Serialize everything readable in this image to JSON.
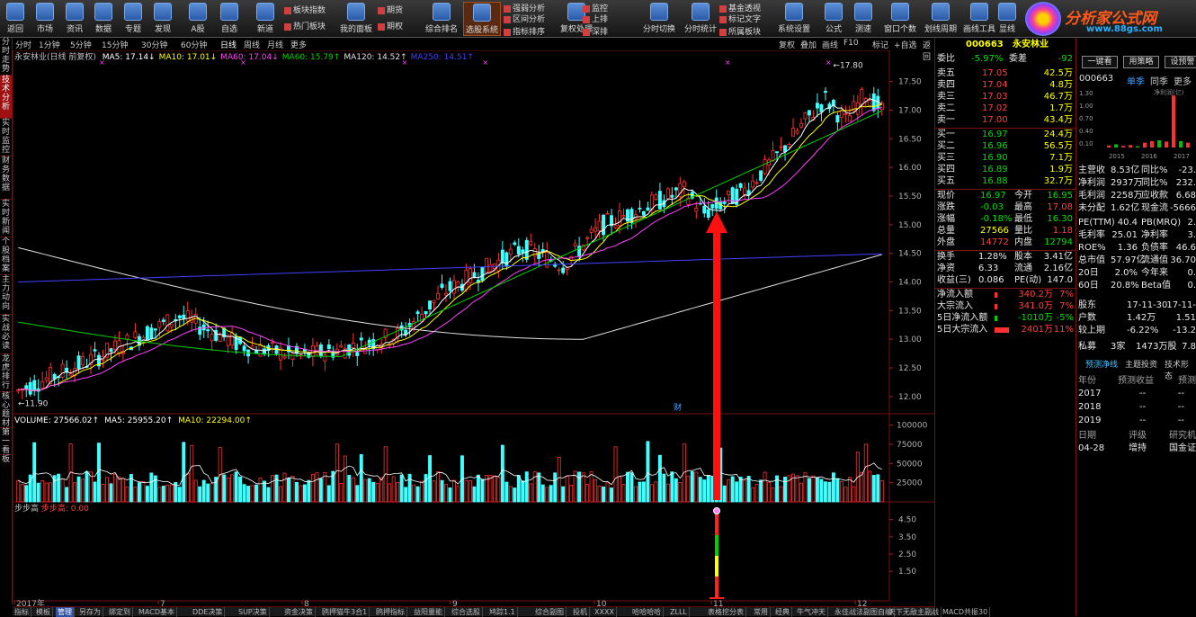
{
  "toolbar": {
    "buttons": [
      {
        "label": "返回",
        "icon": "back-icon"
      },
      {
        "label": "市场",
        "icon": "home-icon"
      },
      {
        "label": "资讯",
        "icon": "home-icon"
      },
      {
        "label": "数据",
        "icon": "home-icon"
      },
      {
        "label": "专题",
        "icon": "home-icon"
      },
      {
        "label": "发现",
        "icon": "home-icon"
      },
      {
        "label": "A股",
        "icon": "chart-icon"
      },
      {
        "label": "自选",
        "icon": "chart-icon"
      },
      {
        "label": "新道",
        "icon": "tools-icon"
      },
      {
        "label": "我的面板",
        "icon": "panel-icon"
      },
      {
        "label": "综合排名",
        "icon": "week-icon"
      },
      {
        "label": "选股系统",
        "icon": "week-icon"
      },
      {
        "label": "复权处理",
        "icon": "magnifier-icon"
      },
      {
        "label": "分时切换",
        "icon": "cursor-icon"
      },
      {
        "label": "分时统计",
        "icon": "pie-icon"
      },
      {
        "label": "系统设置",
        "icon": "settings-icon"
      },
      {
        "label": "公式",
        "icon": "mic-icon"
      },
      {
        "label": "测速",
        "icon": "printer-icon"
      },
      {
        "label": "窗口个数",
        "icon": "week-icon"
      },
      {
        "label": "划线周期",
        "icon": "week-icon"
      },
      {
        "label": "画线工具",
        "icon": "chart-icon"
      },
      {
        "label": "显线",
        "icon": "chart-icon"
      }
    ],
    "small": [
      "板块指数",
      "热门板块",
      "期货",
      "期权",
      "强弱分析",
      "区间分析",
      "指标排序",
      "监控",
      "上排",
      "深排",
      "基金透视",
      "标记文字",
      "所属板块"
    ]
  },
  "logo": {
    "title": "分析家公式网",
    "url": "www.88gs.com"
  },
  "left_tabs": [
    "分时走势",
    "技术分析",
    "实时监控",
    "财务数据",
    "实时新闻",
    "个股档案",
    "主力动向",
    "实战必读",
    "龙虎排行",
    "核心题材",
    "第一看板"
  ],
  "period_bar": [
    "分时",
    "1分钟",
    "5分钟",
    "15分钟",
    "30分钟",
    "60分钟",
    "日线",
    "周线",
    "月线",
    "更多"
  ],
  "period_right": [
    "复权",
    "叠加",
    "画线",
    "F10",
    "标记",
    "+自选",
    "返回"
  ],
  "chart_data": {
    "type": "candlestick",
    "title": "永安林业(日线 前复权)",
    "ma_legend": [
      {
        "label": "MA5: 17.14↓",
        "color": "#ffffff"
      },
      {
        "label": "MA10: 17.01↓",
        "color": "#ffff00"
      },
      {
        "label": "MA60: 17.04↓",
        "color": "#ff40ff"
      },
      {
        "label": "MA60: 15.79↑",
        "color": "#00d000"
      },
      {
        "label": "MA120: 14.52↑",
        "color": "#e0e0e0"
      },
      {
        "label": "MA250: 14.51↑",
        "color": "#4040ff"
      }
    ],
    "y_ticks": [
      17.5,
      17.0,
      16.5,
      16.0,
      15.5,
      15.0,
      14.5,
      14.0,
      13.5,
      13.0,
      12.5,
      12.0
    ],
    "y_range": [
      11.7,
      17.95
    ],
    "high_label": "17.80",
    "low_label": "11.90",
    "x_labels": [
      "2017年",
      "7",
      "8",
      "9",
      "10",
      "11",
      "12"
    ],
    "volume_legend": [
      {
        "label": "VOLUME: 27566.02↑",
        "color": "#ffffff"
      },
      {
        "label": "MA5: 25955.20↑",
        "color": "#ffffff"
      },
      {
        "label": "MA10: 22294.00↑",
        "color": "#ffff00"
      }
    ],
    "volume_ticks": [
      100000,
      75000,
      50000,
      25000
    ],
    "indicator_name": "步步高",
    "indicator_value": "步步高: 0.00",
    "indicator_ticks": [
      4.5,
      3.5,
      2.5,
      1.5
    ],
    "arrow_color": "#ff1010",
    "event_marker": "财"
  },
  "quote": {
    "code": "000663",
    "name": "永安林业",
    "weibi_label": "委比",
    "weibi": "-5.97%",
    "weicha_label": "委差",
    "weicha": "-92",
    "asks": [
      {
        "label": "卖五",
        "price": "17.05",
        "vol": "42.5万"
      },
      {
        "label": "卖四",
        "price": "17.04",
        "vol": "4.8万"
      },
      {
        "label": "卖三",
        "price": "17.03",
        "vol": "46.7万"
      },
      {
        "label": "卖二",
        "price": "17.02",
        "vol": "1.7万"
      },
      {
        "label": "卖一",
        "price": "17.00",
        "vol": "43.4万"
      }
    ],
    "bids": [
      {
        "label": "买一",
        "price": "16.97",
        "vol": "24.4万"
      },
      {
        "label": "买二",
        "price": "16.96",
        "vol": "56.5万"
      },
      {
        "label": "买三",
        "price": "16.90",
        "vol": "7.1万"
      },
      {
        "label": "买四",
        "price": "16.89",
        "vol": "1.9万"
      },
      {
        "label": "买五",
        "price": "16.88",
        "vol": "32.7万"
      }
    ],
    "stats": [
      {
        "l1": "现价",
        "v1": "16.97",
        "c1": "green",
        "l2": "今开",
        "v2": "16.95",
        "c2": "green"
      },
      {
        "l1": "涨跌",
        "v1": "-0.03",
        "c1": "green",
        "l2": "最高",
        "v2": "17.08",
        "c2": "red"
      },
      {
        "l1": "涨幅",
        "v1": "-0.18%",
        "c1": "green",
        "l2": "最低",
        "v2": "16.30",
        "c2": "green"
      },
      {
        "l1": "总量",
        "v1": "27566",
        "c1": "yellow",
        "l2": "量比",
        "v2": "1.18",
        "c2": "red"
      },
      {
        "l1": "外盘",
        "v1": "14772",
        "c1": "red",
        "l2": "内盘",
        "v2": "12794",
        "c2": "green"
      }
    ],
    "stats2": [
      {
        "l1": "换手",
        "v1": "1.28%",
        "l2": "股本",
        "v2": "3.41亿"
      },
      {
        "l1": "净资",
        "v1": "6.33",
        "l2": "流通",
        "v2": "2.16亿"
      },
      {
        "l1": "收益(三)",
        "v1": "0.086",
        "l2": "PE(动)",
        "v2": "147.0"
      }
    ],
    "flows": [
      {
        "label": "净流入额",
        "val": "340.2万",
        "pct": "7%",
        "c": "red"
      },
      {
        "label": "大宗流入",
        "val": "341.0万",
        "pct": "7%",
        "c": "red"
      },
      {
        "label": "5日净流入额",
        "val": "-1010万",
        "pct": "-5%",
        "c": "green"
      },
      {
        "label": "5日大宗流入",
        "val": "2401万",
        "pct": "11%",
        "c": "red"
      }
    ]
  },
  "far": {
    "buttons": [
      "一键看",
      "用策略",
      "设预警"
    ],
    "code": "000663",
    "tabs": [
      "单季",
      "同季",
      "更多"
    ],
    "mini_chart_label": "净利润(亿)",
    "mini_ticks": [
      "1.30",
      "1.00",
      "0.70",
      "0.40",
      "0.10"
    ],
    "mini_years": [
      "2015",
      "2016",
      "2017"
    ],
    "mini_values": [
      0.05,
      0.08,
      0.04,
      0.06,
      0.03,
      0.12,
      0.16,
      0.18,
      0.15,
      1.3,
      0.16,
      0.12
    ],
    "rows": [
      {
        "a": "主营收",
        "b": "8.53亿",
        "c": "同比%",
        "d": "-23."
      },
      {
        "a": "净利润",
        "b": "2937万",
        "c": "同比%",
        "d": "232."
      },
      {
        "a": "毛利润",
        "b": "2258万",
        "c": "应收款",
        "d": "6.68"
      },
      {
        "a": "未分配",
        "b": "1.62亿",
        "c": "现金流",
        "d": "-5666"
      },
      {
        "a": "PE(TTM)",
        "b": "40.4",
        "c": "PB(MRQ)",
        "d": "2."
      },
      {
        "a": "毛利率",
        "b": "25.01",
        "c": "净利率",
        "d": "3."
      },
      {
        "a": "ROE%",
        "b": "1.36",
        "c": "负债率",
        "d": "46.6"
      },
      {
        "a": "总市值",
        "b": "57.97亿",
        "c": "流通值",
        "d": "36.70"
      },
      {
        "a": "20日",
        "b": "2.0%",
        "c": "今年来",
        "d": "0."
      },
      {
        "a": "60日",
        "b": "20.8%",
        "c": "Beta值",
        "d": "0."
      }
    ],
    "holders": [
      {
        "a": "股东",
        "b": "17-11-30",
        "c": "17-11-"
      },
      {
        "a": "户数",
        "b": "1.42万",
        "c": "1.51"
      },
      {
        "a": "较上期",
        "b": "-6.22%",
        "c": "-13.2"
      }
    ],
    "private": {
      "a": "私募",
      "b": "3家",
      "c": "1473万股",
      "d": "7.8"
    },
    "tabs2": [
      "预测净线",
      "主题投资",
      "技术形态"
    ],
    "forecast_head": {
      "a": "年份",
      "b": "预测收益",
      "c": "预测"
    },
    "forecast": [
      {
        "a": "2017",
        "b": "--",
        "c": "--"
      },
      {
        "a": "2018",
        "b": "--",
        "c": "--"
      },
      {
        "a": "2019",
        "b": "--",
        "c": "--"
      }
    ],
    "rating_head": {
      "a": "日期",
      "b": "评级",
      "c": "研究机"
    },
    "rating": {
      "a": "04-28",
      "b": "增持",
      "c": "国金证"
    }
  },
  "bottom_tabs": [
    "指标",
    "模板",
    "管理",
    "另存为",
    "绑定到",
    "MACD基本",
    "DDE决策",
    "SUP决策",
    "资金决策",
    "鸥押猫牛3合1",
    "鸥押指标",
    "益阳量能",
    "综合选股",
    "鸠踪1.1",
    "综合副图",
    "投机",
    "XXXX",
    "哈哈哈哈",
    "ZLLL",
    "表格挖分表",
    "常用",
    "经典",
    "牛气冲天",
    "永佳战法副图自编",
    "天下无敌主副战",
    "MACD共振30"
  ]
}
